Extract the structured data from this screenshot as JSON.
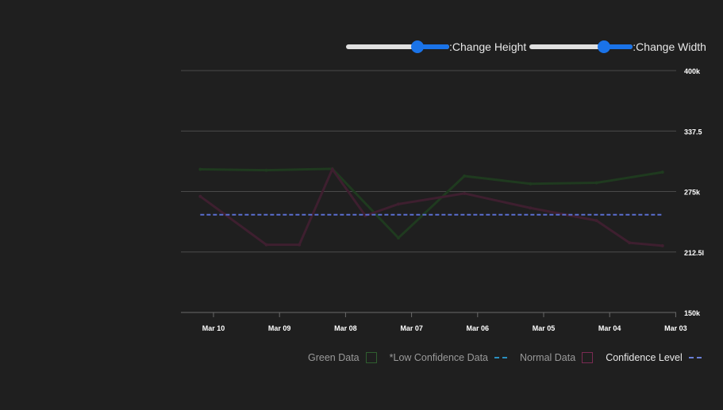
{
  "controls": {
    "height_label": ":Change Height",
    "width_label": ":Change Width",
    "height_value": 0.72,
    "width_value": 0.75,
    "accent_color": "#1a73e8"
  },
  "legend": [
    {
      "label": "Green Data",
      "text_color": "#9a9a9a",
      "swatch": "box",
      "color": "#2f5e2f"
    },
    {
      "label": "*Low Confidence Data",
      "text_color": "#9a9a9a",
      "swatch": "dash",
      "color": "#2a8fbf"
    },
    {
      "label": "Normal Data",
      "text_color": "#9a9a9a",
      "swatch": "box",
      "color": "#7a2a52"
    },
    {
      "label": "Confidence Level",
      "text_color": "#e8e8e8",
      "swatch": "dash",
      "color": "#6a7fd6"
    }
  ],
  "chart_data": {
    "type": "line",
    "categories": [
      "Mar 10",
      "Mar 09",
      "Mar 08",
      "Mar 07",
      "Mar 06",
      "Mar 05",
      "Mar 04",
      "Mar 03"
    ],
    "x_ticks": [
      "Mar 10",
      "Mar 09",
      "Mar 08",
      "Mar 07",
      "Mar 06",
      "Mar 05",
      "Mar 04",
      "Mar 03"
    ],
    "y_ticks": [
      "400k",
      "337.5",
      "275k",
      "212.5l",
      "150k"
    ],
    "ylim": [
      150000,
      400000
    ],
    "y_axis_side": "right",
    "grid": true,
    "series": [
      {
        "name": "Green Data",
        "color": "#1f3a1f",
        "style": "solid",
        "x": [
          -0.2,
          0.8,
          1.8,
          2.8,
          3.8,
          4.8,
          5.8,
          6.8
        ],
        "values": [
          298000,
          297000,
          298500,
          227000,
          291000,
          283000,
          284000,
          295000
        ]
      },
      {
        "name": "Normal Data",
        "color": "#3e1f2f",
        "style": "solid",
        "x": [
          -0.2,
          0.8,
          1.3,
          1.8,
          2.3,
          2.8,
          3.8,
          4.8,
          5.8,
          6.3,
          6.8
        ],
        "values": [
          270000,
          220000,
          220000,
          298000,
          250000,
          262000,
          273000,
          258000,
          245000,
          222000,
          219000
        ]
      },
      {
        "name": "Confidence Level",
        "color": "#5a6fd0",
        "style": "dashed",
        "x": [
          -0.2,
          6.8
        ],
        "values": [
          251000,
          251000
        ]
      }
    ]
  }
}
